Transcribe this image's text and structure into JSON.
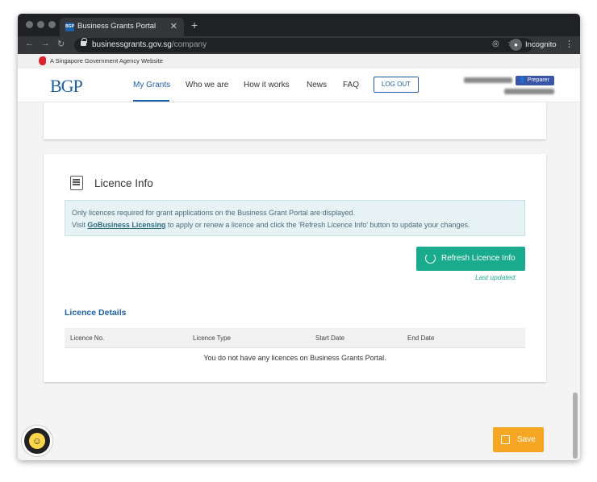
{
  "browser": {
    "tab_title": "Business Grants Portal",
    "tab_favicon_text": "BGP",
    "url_host": "businessgrants.gov.sg",
    "url_path": "/company",
    "incognito_label": "Incognito"
  },
  "gov_banner": {
    "text": "A Singapore Government Agency Website"
  },
  "header": {
    "logo": "BGP",
    "nav": [
      "My Grants",
      "Who we are",
      "How it works",
      "News",
      "FAQ"
    ],
    "logout_label": "LOG OUT",
    "role_badge": "Preparer"
  },
  "licence": {
    "title": "Licence Info",
    "info_line1": "Only licences required for grant applications on the Business Grant Portal are displayed.",
    "info_line2_prefix": "Visit ",
    "info_link": "GoBusiness Licensing",
    "info_line2_suffix": " to apply or renew a licence and click the 'Refresh Licence Info' button to update your changes.",
    "refresh_label": "Refresh Licence Info",
    "last_updated": "Last updated:",
    "details_title": "Licence Details",
    "columns": [
      "Licence No.",
      "Licence Type",
      "Start Date",
      "End Date"
    ],
    "empty_message": "You do not have any licences on Business Grants Portal."
  },
  "footer": {
    "save_label": "Save"
  },
  "colors": {
    "brand": "#1d5fa6",
    "accent": "#1aaa8c",
    "save": "#f5a623"
  }
}
